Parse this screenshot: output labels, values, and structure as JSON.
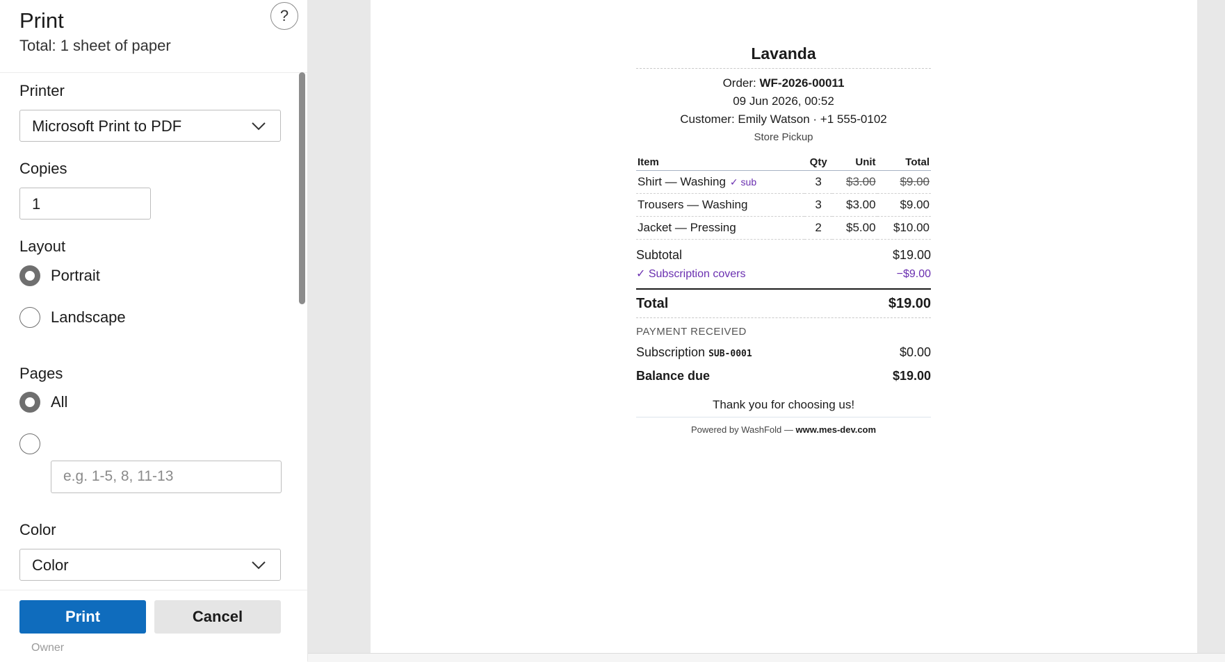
{
  "dialog": {
    "title": "Print",
    "subtitle": "Total: 1 sheet of paper",
    "help_glyph": "?"
  },
  "printer": {
    "label": "Printer",
    "value": "Microsoft Print to PDF"
  },
  "copies": {
    "label": "Copies",
    "value": "1"
  },
  "layout": {
    "label": "Layout",
    "options": [
      "Portrait",
      "Landscape"
    ],
    "selected": "Portrait"
  },
  "pages": {
    "label": "Pages",
    "all_label": "All",
    "range_placeholder": "e.g. 1-5, 8, 11-13",
    "selected": "All"
  },
  "color": {
    "label": "Color",
    "value": "Color"
  },
  "buttons": {
    "print": "Print",
    "cancel": "Cancel"
  },
  "background": {
    "owner_text": "Owner"
  },
  "receipt": {
    "store": "Lavanda",
    "order_label": "Order:",
    "order_number": "WF-2026-00011",
    "datetime": "09 Jun 2026, 00:52",
    "customer": "Customer: Emily Watson · +1 555-0102",
    "delivery": "Store Pickup",
    "columns": [
      "Item",
      "Qty",
      "Unit",
      "Total"
    ],
    "items": [
      {
        "item": "Shirt — Washing",
        "tag": "✓ sub",
        "qty": "3",
        "unit": "$3.00",
        "total": "$9.00"
      },
      {
        "item": "Trousers — Washing",
        "tag": "",
        "qty": "3",
        "unit": "$3.00",
        "total": "$9.00"
      },
      {
        "item": "Jacket — Pressing",
        "tag": "",
        "qty": "2",
        "unit": "$5.00",
        "total": "$10.00"
      }
    ],
    "subtotal_label": "Subtotal",
    "subtotal": "$19.00",
    "subscription_label": "✓ Subscription covers",
    "subscription_amount": "−$9.00",
    "total_label": "Total",
    "total": "$19.00",
    "payment_heading": "PAYMENT RECEIVED",
    "payment_label": "Subscription",
    "payment_code": "SUB-0001",
    "payment_amount": "$0.00",
    "balance_label": "Balance due",
    "balance": "$19.00",
    "thanks": "Thank you for choosing us!",
    "powered_prefix": "Powered by WashFold — ",
    "powered_site": "www.mes-dev.com"
  },
  "colors": {
    "primary_button": "#0f6cbd",
    "subscription_accent": "#6a2fb0"
  }
}
